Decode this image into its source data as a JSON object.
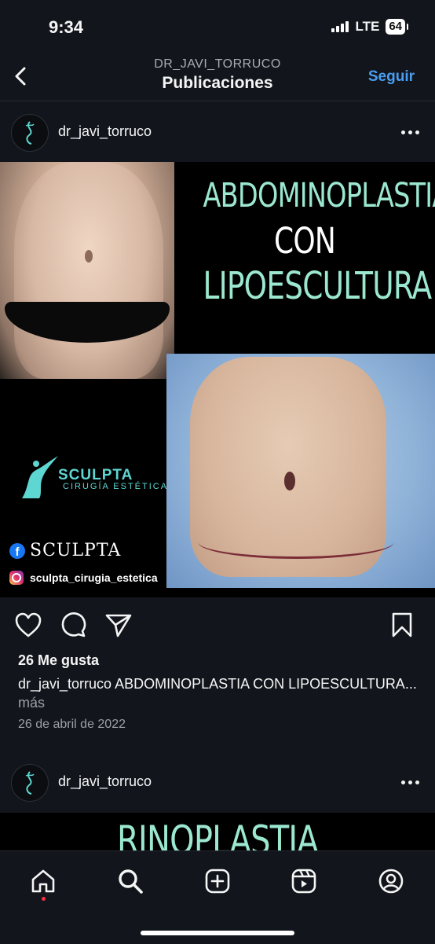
{
  "status": {
    "time": "9:34",
    "network": "LTE",
    "battery": "64"
  },
  "header": {
    "subtitle": "DR_JAVI_TORRUCO",
    "title": "Publicaciones",
    "follow_label": "Seguir"
  },
  "posts": [
    {
      "username": "dr_javi_torruco",
      "image": {
        "title_line1": "ABDOMINOPLASTIA",
        "title_line2": "CON",
        "title_line3": "LIPOESCULTURA",
        "brand": "SCULPTA",
        "brand_sub": "CIRUGÍA ESTÉTICA",
        "facebook_handle": "SCULPTA",
        "instagram_handle": "sculpta_cirugia_estetica"
      },
      "likes": "26 Me gusta",
      "caption_user": "dr_javi_torruco",
      "caption_text": " ABDOMINOPLASTIA CON LIPOESCULTURA...",
      "caption_more": " más",
      "date": "26 de abril de 2022"
    },
    {
      "username": "dr_javi_torruco",
      "image": {
        "title_line1": "RINOPLASTIA"
      }
    }
  ],
  "colors": {
    "accent": "#4a9df0",
    "background": "#12161c",
    "mint": "#9be7cf",
    "brand_teal": "#5ed6d1"
  },
  "icons": [
    "back-chevron-icon",
    "more-icon",
    "heart-icon",
    "comment-icon",
    "share-icon",
    "bookmark-icon",
    "home-icon",
    "search-icon",
    "create-icon",
    "reels-icon",
    "profile-icon"
  ]
}
